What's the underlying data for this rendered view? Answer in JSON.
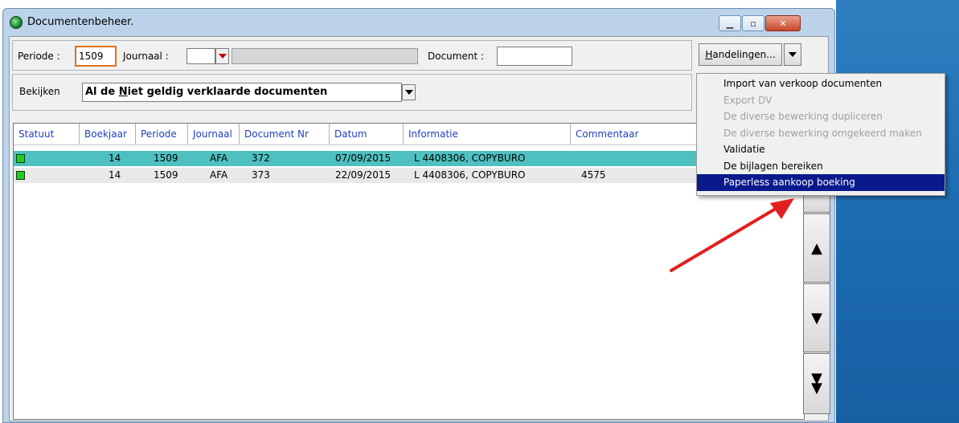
{
  "window": {
    "title": "Documentenbeheer."
  },
  "filters": {
    "periode_label": "Periode :",
    "periode_value": "1509",
    "journaal_label": "Journaal :",
    "journaal_value": "",
    "journaal_desc": "",
    "document_label": "Document :",
    "document_value": "",
    "bekijken_label": "Bekijken",
    "bekijken_value_pre": "Al de ",
    "bekijken_value_u": "N",
    "bekijken_value_post": "iet geldig verklaarde documenten"
  },
  "handelingen": {
    "label_u": "H",
    "label_rest": "andelingen..."
  },
  "columns": [
    "Statuut",
    "Boekjaar",
    "Periode",
    "Journaal",
    "Document Nr",
    "Datum",
    "Informatie",
    "Commentaar"
  ],
  "rows": [
    {
      "boekjaar": "14",
      "periode": "1509",
      "journaal": "AFA",
      "document_nr": "372",
      "datum": "07/09/2015",
      "informatie": "L 4408306, COPYBURO",
      "commentaar": "",
      "selected": true,
      "status_color": "#22cc22"
    },
    {
      "boekjaar": "14",
      "periode": "1509",
      "journaal": "AFA",
      "document_nr": "373",
      "datum": "22/09/2015",
      "informatie": "L 4408306, COPYBURO",
      "commentaar": "4575",
      "selected": false,
      "status_color": "#22cc22"
    }
  ],
  "menu": {
    "items": [
      {
        "label": "Import van verkoop documenten",
        "enabled": true,
        "highlighted": false
      },
      {
        "label": "Export DV",
        "enabled": false,
        "highlighted": false
      },
      {
        "label": "De diverse bewerking dupliceren",
        "enabled": false,
        "highlighted": false
      },
      {
        "label": "De diverse bewerking omgekeerd maken",
        "enabled": false,
        "highlighted": false
      },
      {
        "label": "Validatie",
        "enabled": true,
        "highlighted": false
      },
      {
        "label": "De bijlagen bereiken",
        "enabled": true,
        "highlighted": false
      },
      {
        "label": "Paperless aankoop boeking",
        "enabled": true,
        "highlighted": true
      }
    ]
  },
  "colors": {
    "selected_row": "#4fc0c0",
    "menu_highlight": "#0a1a8c",
    "focus_border": "#e07020",
    "annotation_arrow": "#e02020"
  }
}
